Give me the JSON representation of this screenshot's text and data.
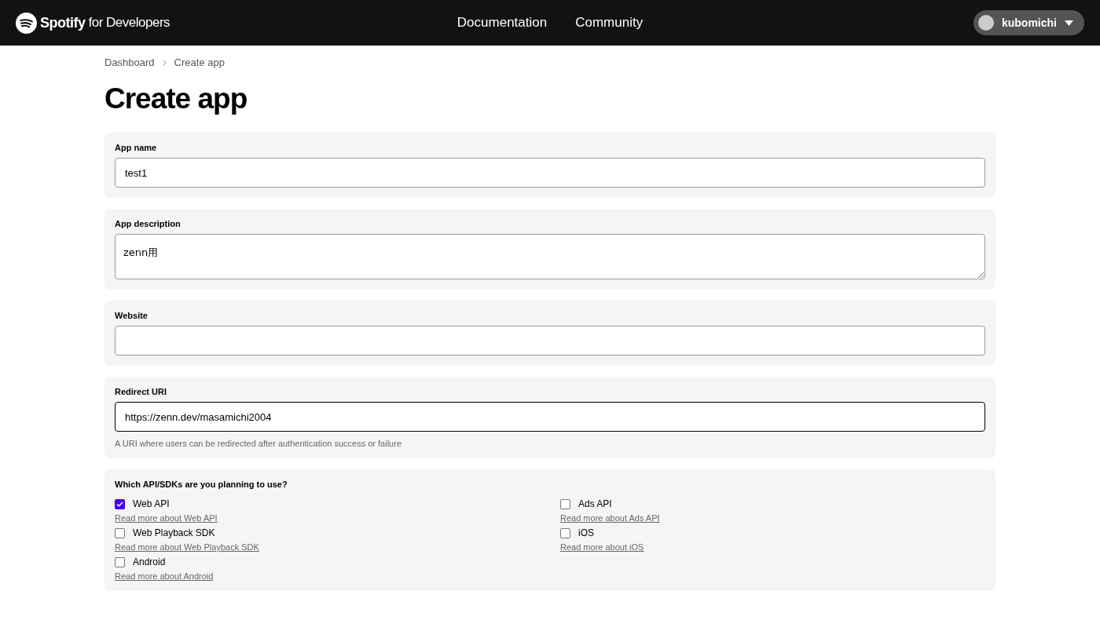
{
  "header": {
    "brand": {
      "name": "Spotify",
      "suffix": "for Developers"
    },
    "nav": [
      "Documentation",
      "Community"
    ],
    "user": {
      "name": "kubomichi"
    }
  },
  "breadcrumb": [
    "Dashboard",
    "Create app"
  ],
  "title": "Create app",
  "fields": [
    {
      "label": "App name",
      "kind": "text",
      "value": "test1",
      "focused": false
    },
    {
      "label": "App description",
      "kind": "textarea",
      "value": "zenn用",
      "focused": false
    },
    {
      "label": "Website",
      "kind": "text",
      "focused": false
    },
    {
      "label": "Redirect URI",
      "kind": "text",
      "value": "https://zenn.dev/masamichi2004",
      "focused": true,
      "hint": "A URI where users can be redirected after authentication success or failure"
    }
  ],
  "apis": {
    "label": "Which API/SDKs are you planning to use?",
    "options": [
      {
        "label": "Web API",
        "checked": true,
        "link": "Read more about Web API"
      },
      {
        "label": "Ads API",
        "checked": false,
        "link": "Read more about Ads API"
      },
      {
        "label": "Web Playback SDK",
        "checked": false,
        "link": "Read more about Web Playback SDK"
      },
      {
        "label": "iOS",
        "checked": false,
        "link": "Read more about iOS"
      },
      {
        "label": "Android",
        "checked": false,
        "link": "Read more about Android"
      }
    ]
  }
}
